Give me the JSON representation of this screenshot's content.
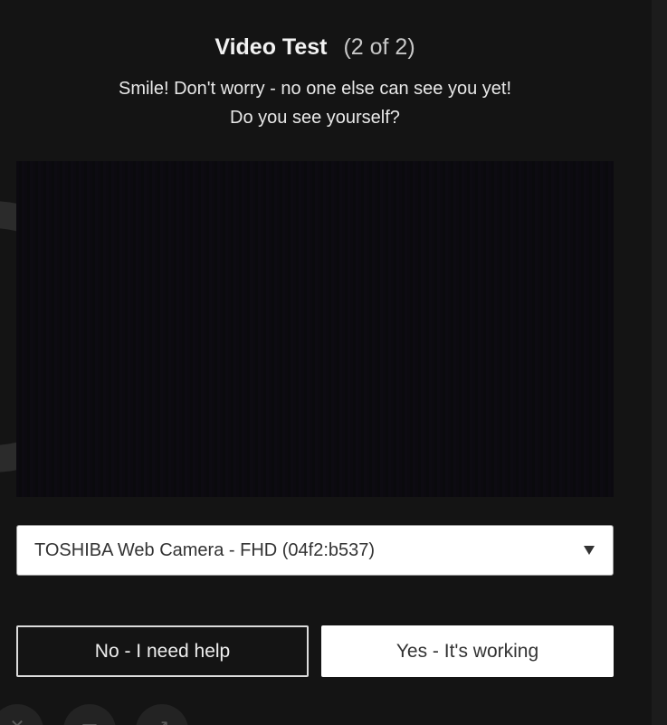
{
  "dialog": {
    "title": "Video Test",
    "step": "(2 of 2)",
    "message_line1": "Smile! Don't worry - no one else can see you yet!",
    "message_line2": "Do you see yourself?"
  },
  "camera_select": {
    "selected": "TOSHIBA Web Camera - FHD (04f2:b537)"
  },
  "buttons": {
    "no_label": "No - I need help",
    "yes_label": "Yes - It's working"
  },
  "bottom_toolbar": {
    "icons": [
      "mic-off-icon",
      "video-icon",
      "share-icon"
    ]
  },
  "colors": {
    "background": "#141414",
    "button_primary": "#ffffff",
    "button_outline": "#dcdcdc"
  }
}
